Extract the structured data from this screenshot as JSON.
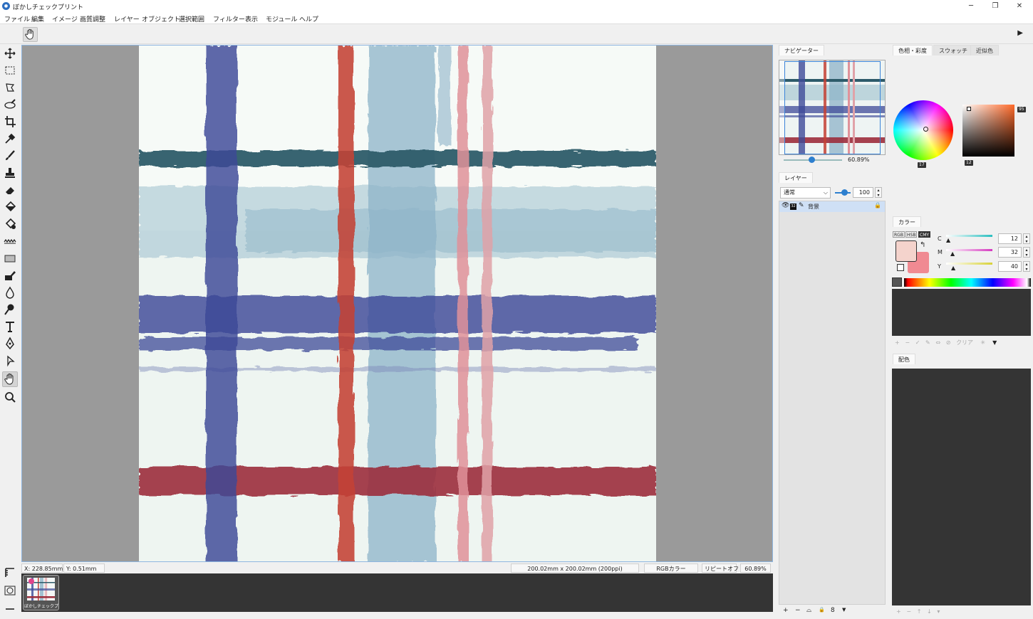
{
  "app": {
    "title": "ぼかしチェックプリント"
  },
  "menu": [
    "ファイル",
    "編集",
    "イメージ",
    "画質調整",
    "レイヤー",
    "オブジェクト",
    "選択範囲",
    "フィルター",
    "表示",
    "モジュール",
    "ヘルプ"
  ],
  "status": {
    "x_label": "X:",
    "x_value": "228.85mm",
    "y_label": "Y:",
    "y_value": "0.51mm",
    "doc_size": "200.02mm x 200.02mm (200ppi)",
    "color_mode": "RGBカラー",
    "repeat": "リピートオフ",
    "zoom": "60.89%"
  },
  "doc_tab": {
    "label": "ぼかしチェックプ"
  },
  "navigator": {
    "tab": "ナビゲーター",
    "zoom": "60.89%"
  },
  "layers": {
    "tab": "レイヤー",
    "blend_mode": "通常",
    "opacity": "100",
    "items": [
      {
        "name": "背景",
        "bit_depth": "32"
      }
    ]
  },
  "color_tabs": [
    "色相・彩度",
    "スウォッチ",
    "近似色"
  ],
  "hsv": {
    "hue": "17",
    "value": "12",
    "saturation": "95"
  },
  "color_panel": {
    "tab": "カラー",
    "modes": [
      "RGB",
      "HSB",
      "CMY"
    ],
    "active_mode": "CMY",
    "fg_color": "#f4d3cc",
    "bg_color": "#f08a92",
    "channels": [
      {
        "name": "C",
        "value": "12",
        "color": "#2bbfc0"
      },
      {
        "name": "M",
        "value": "32",
        "color": "#d63bc0"
      },
      {
        "name": "Y",
        "value": "40",
        "color": "#d8d23a"
      }
    ],
    "clear_label": "クリア"
  },
  "harmony": {
    "tab": "配色"
  },
  "colors": {
    "accent": "#2d7fcf",
    "navy_stripe": "#3d4a98",
    "red_stripe": "#c44235",
    "blue_stripe": "#8db3c8",
    "pink_stripe": "#e0929a",
    "teal_stripe": "#2d5b6a",
    "wine_stripe": "#9c2e3c"
  },
  "tools": [
    "move-icon",
    "rect-select-icon",
    "lasso-icon",
    "magic-select-icon",
    "crop-icon",
    "eyedropper-icon",
    "brush-icon",
    "stamp-icon",
    "eraser-icon",
    "fill-icon",
    "gradient-fill-icon",
    "texture-icon",
    "shape-icon",
    "pattern-icon",
    "blur-drop-icon",
    "dodge-icon",
    "text-icon",
    "pen-icon",
    "path-select-icon",
    "hand-icon",
    "zoom-icon"
  ]
}
